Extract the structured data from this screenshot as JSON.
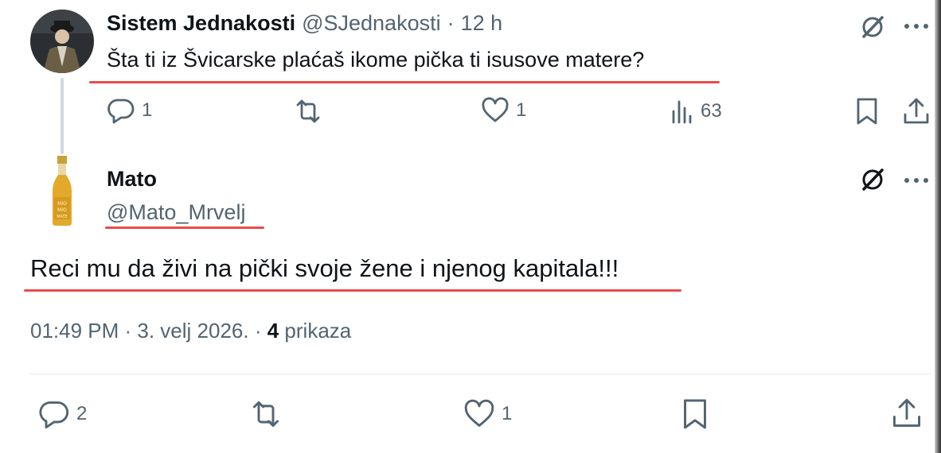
{
  "reply": {
    "name": "Sistem Jednakosti",
    "handle": "@SJednakosti",
    "separator": "·",
    "time": "12 h",
    "text": "Šta ti iz Švicarske plaćaš ikome pička ti isusove matere?",
    "stats": {
      "replies": "1",
      "likes": "1",
      "views": "63"
    }
  },
  "main": {
    "name": "Mato",
    "handle": "@Mato_Mrvelj",
    "text": "Reci mu da živi na pički svoje žene i njenog kapitala!!!",
    "timestamp": "01:49 PM · 3. velj 2026. · ",
    "views_count": "4",
    "views_label": "prikaza",
    "stats": {
      "replies": "2",
      "likes": "1"
    }
  },
  "icons": [
    "grok-icon",
    "more-icon",
    "reply-icon",
    "retweet-icon",
    "like-icon",
    "views-icon",
    "bookmark-icon",
    "share-icon"
  ],
  "colors": {
    "text": "#0f1419",
    "muted": "#536471",
    "underline": "#e53935"
  }
}
